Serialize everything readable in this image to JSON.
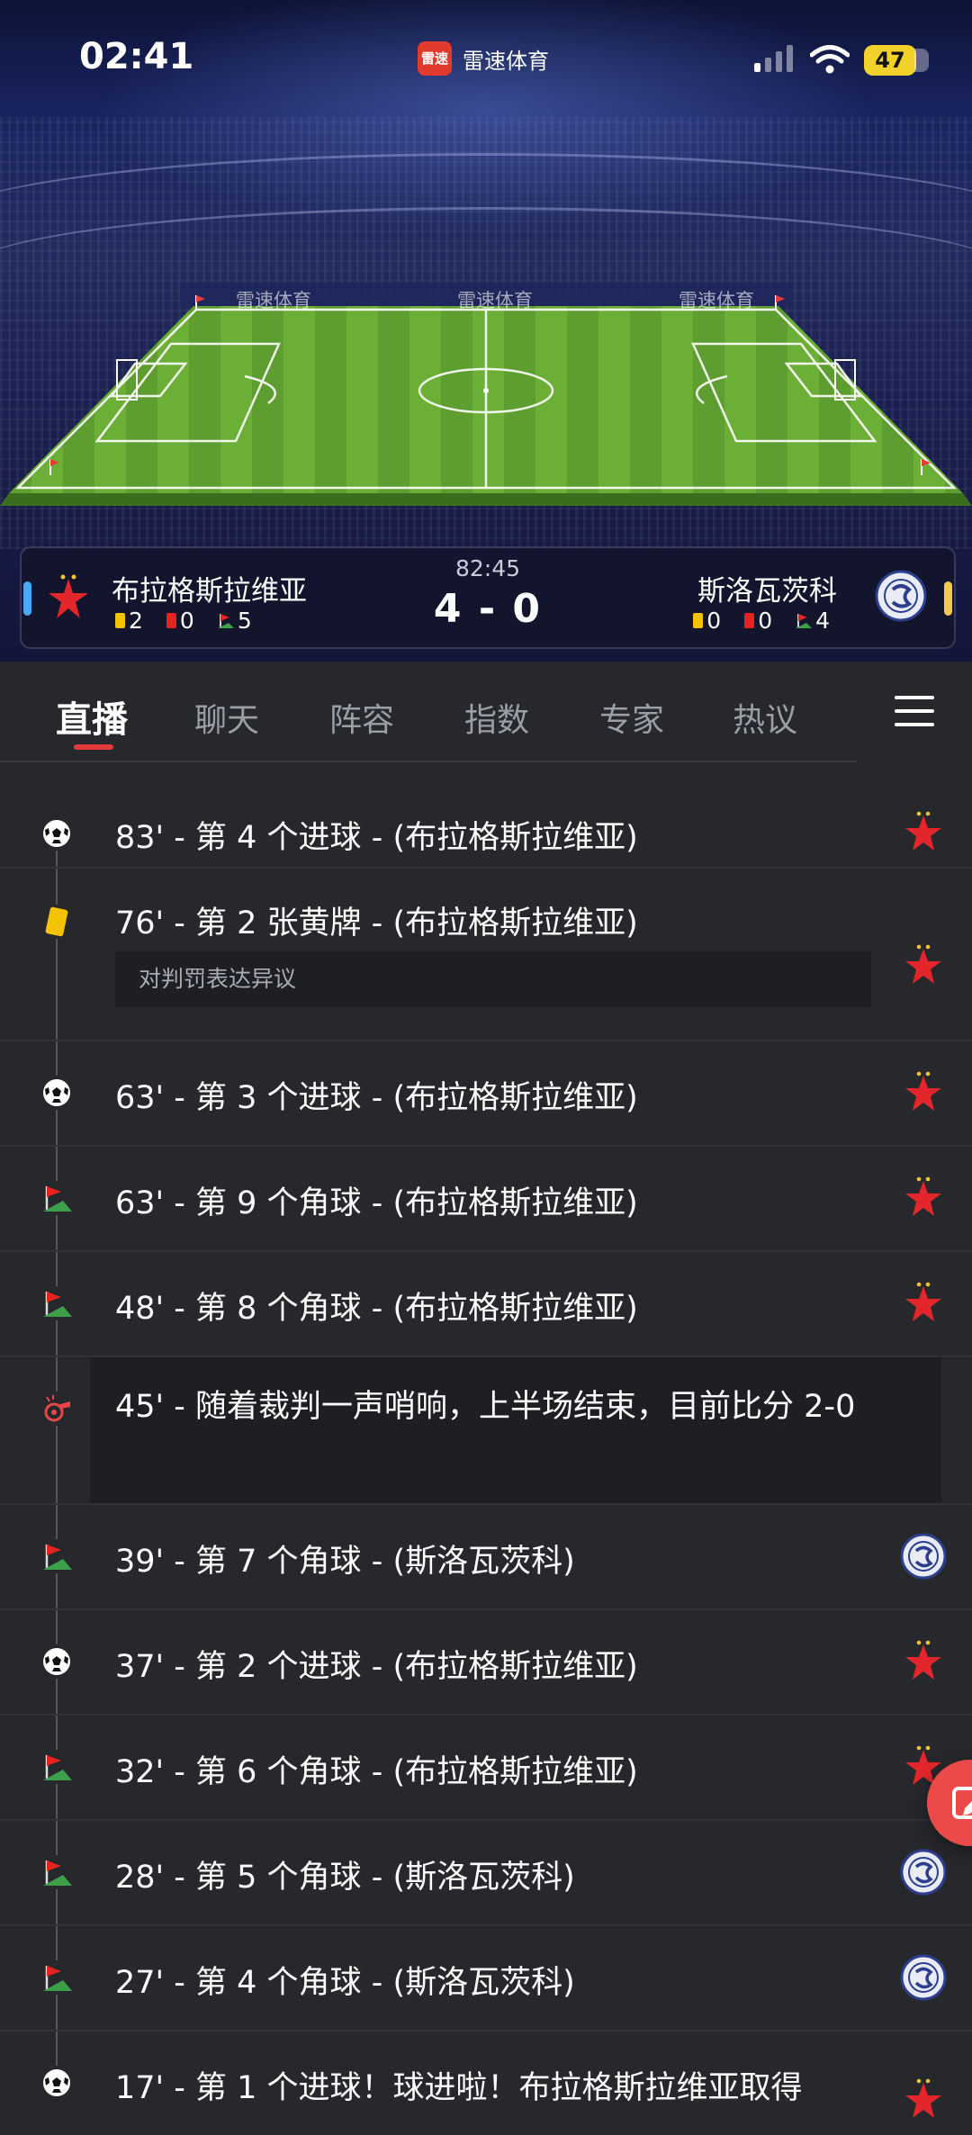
{
  "status_bar": {
    "time": "02:41",
    "app_badge": "雷速",
    "app_name": "雷速体育",
    "battery": "47"
  },
  "stadium": {
    "board_text": "雷速体育"
  },
  "match": {
    "minute": "82:45",
    "score": "4 - 0",
    "home": {
      "name": "布拉格斯拉维亚",
      "yellow_cards": "2",
      "red_cards": "0",
      "corners": "5",
      "accent": "#4aa8f5"
    },
    "away": {
      "name": "斯洛瓦茨科",
      "yellow_cards": "0",
      "red_cards": "0",
      "corners": "4",
      "accent": "#f2c94c"
    }
  },
  "tabs": [
    {
      "label": "直播",
      "active": true
    },
    {
      "label": "聊天"
    },
    {
      "label": "阵容"
    },
    {
      "label": "指数"
    },
    {
      "label": "专家"
    },
    {
      "label": "热议"
    }
  ],
  "events": [
    {
      "icon": "soccer-ball-icon",
      "team": "home",
      "text": "83' - 第 4 个进球 - (布拉格斯拉维亚)"
    },
    {
      "icon": "yellow-card-icon",
      "team": "home",
      "text": "76' - 第 2 张黄牌 - (布拉格斯拉维亚)",
      "note": "对判罚表达异议"
    },
    {
      "icon": "soccer-ball-icon",
      "team": "home",
      "text": "63' - 第 3 个进球 - (布拉格斯拉维亚)"
    },
    {
      "icon": "corner-flag-icon",
      "team": "home",
      "text": "63' - 第 9 个角球 - (布拉格斯拉维亚)"
    },
    {
      "icon": "corner-flag-icon",
      "team": "home",
      "text": "48' - 第 8 个角球 - (布拉格斯拉维亚)"
    },
    {
      "icon": "whistle-icon",
      "team": "",
      "text": "45' - 随着裁判一声哨响，上半场结束，目前比分 2-0"
    },
    {
      "icon": "corner-flag-icon",
      "team": "away",
      "text": "39' - 第 7 个角球 - (斯洛瓦茨科)"
    },
    {
      "icon": "soccer-ball-icon",
      "team": "home",
      "text": "37' - 第 2 个进球 - (布拉格斯拉维亚)"
    },
    {
      "icon": "corner-flag-icon",
      "team": "home",
      "text": "32' - 第 6 个角球 - (布拉格斯拉维亚)"
    },
    {
      "icon": "corner-flag-icon",
      "team": "away",
      "text": "28' - 第 5 个角球 - (斯洛瓦茨科)"
    },
    {
      "icon": "corner-flag-icon",
      "team": "away",
      "text": "27' - 第 4 个角球 - (斯洛瓦茨科)"
    },
    {
      "icon": "soccer-ball-icon",
      "team": "home",
      "text": "17' - 第 1 个进球！球进啦！布拉格斯拉维亚取得"
    }
  ],
  "colors": {
    "background": "#27282c",
    "accent_red": "#e23a3a",
    "yellow_card": "#f3c200",
    "red_card": "#e5231f"
  }
}
